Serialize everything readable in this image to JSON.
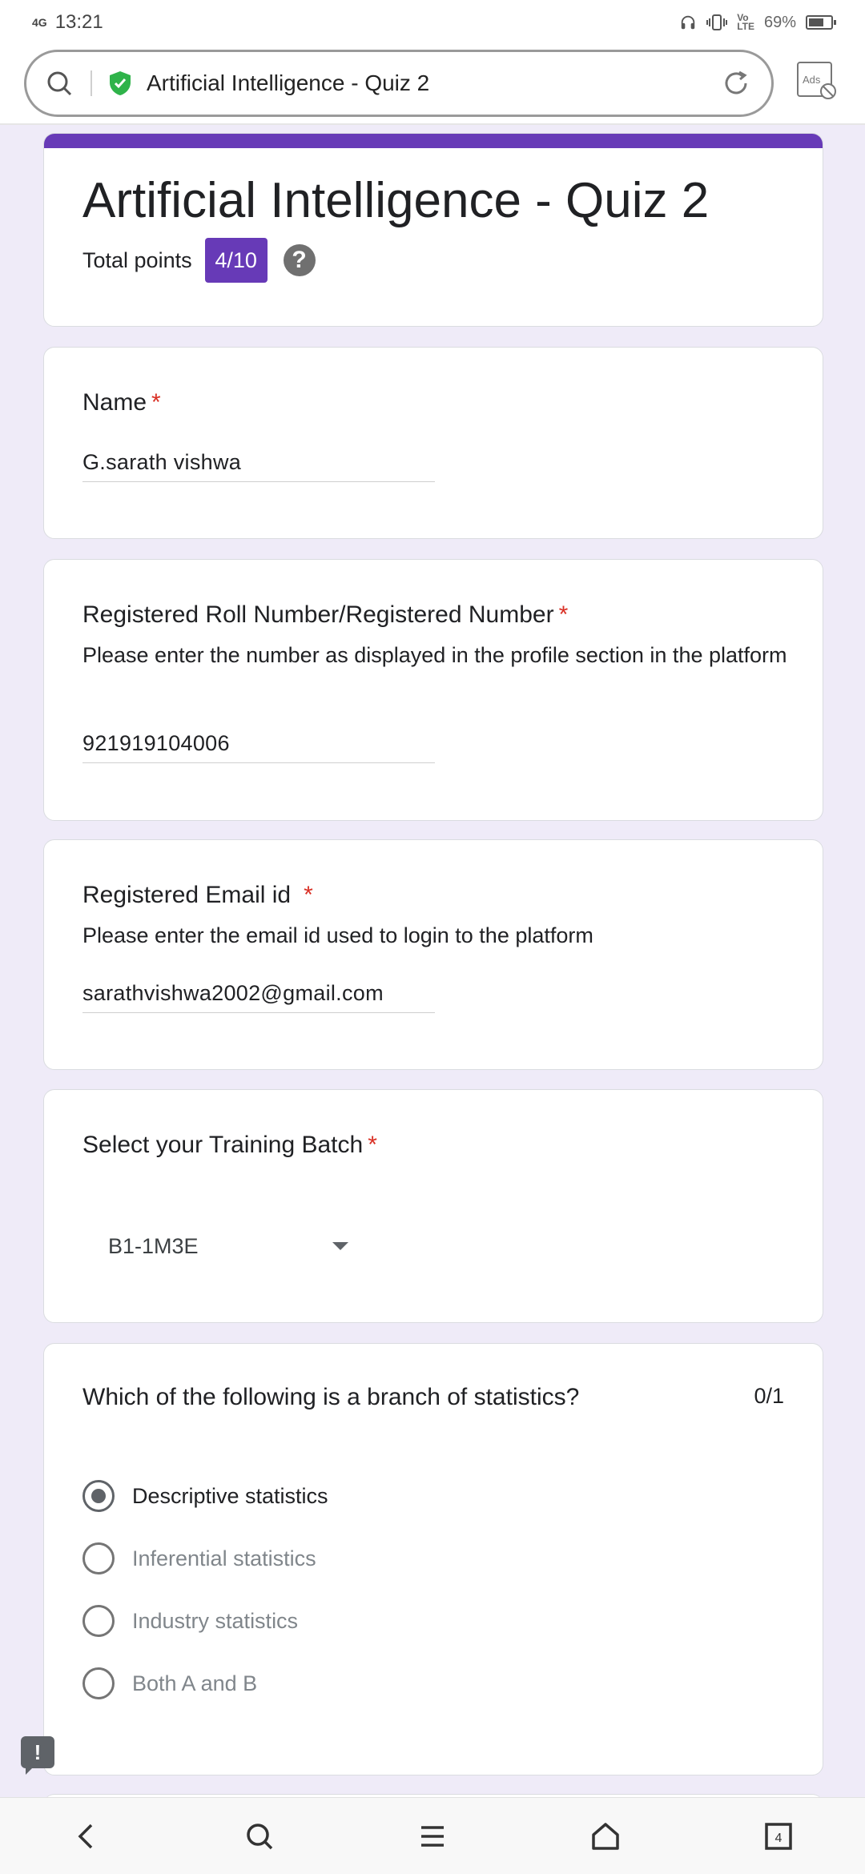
{
  "status_bar": {
    "network": "4G",
    "time": "13:21",
    "battery": "69%",
    "battery_level": 0.69,
    "icons": [
      "headphones-icon",
      "vibrate-icon",
      "volte-icon",
      "battery-icon"
    ]
  },
  "browser": {
    "url_title": "Artificial Intelligence - Quiz 2",
    "ads_label": "Ads",
    "icons": [
      "search-icon",
      "shield-check-icon",
      "reload-icon",
      "ads-block-icon"
    ]
  },
  "form": {
    "title": "Artificial Intelligence - Quiz 2",
    "points_label": "Total points",
    "points_value": "4/10",
    "help": "?",
    "accent": "#673ab7"
  },
  "questions": {
    "name": {
      "title": "Name",
      "required": "*",
      "answer": "G.sarath vishwa"
    },
    "roll": {
      "title": "Registered Roll Number/Registered Number",
      "required": "*",
      "description": "Please enter the number as displayed in the profile section in the platform",
      "answer": "921919104006"
    },
    "email": {
      "title": "Registered Email id",
      "required": "*",
      "description": "Please enter the email id used to login to the platform",
      "answer": "sarathvishwa2002@gmail.com"
    },
    "batch": {
      "title": "Select your Training Batch",
      "required": "*",
      "selected": "B1-1M3E"
    },
    "q1": {
      "title": "Which of the following is a branch of statistics?",
      "score": "0/1",
      "options": [
        {
          "label": "Descriptive statistics",
          "checked": true
        },
        {
          "label": "Inferential statistics",
          "checked": false
        },
        {
          "label": "Industry statistics",
          "checked": false
        },
        {
          "label": "Both A and B",
          "checked": false
        }
      ]
    }
  },
  "feedback": {
    "label": "!"
  },
  "nav": {
    "buttons": [
      "back-icon",
      "search-icon",
      "menu-icon",
      "home-icon",
      "tabs-icon"
    ],
    "tabs_count": "4"
  }
}
